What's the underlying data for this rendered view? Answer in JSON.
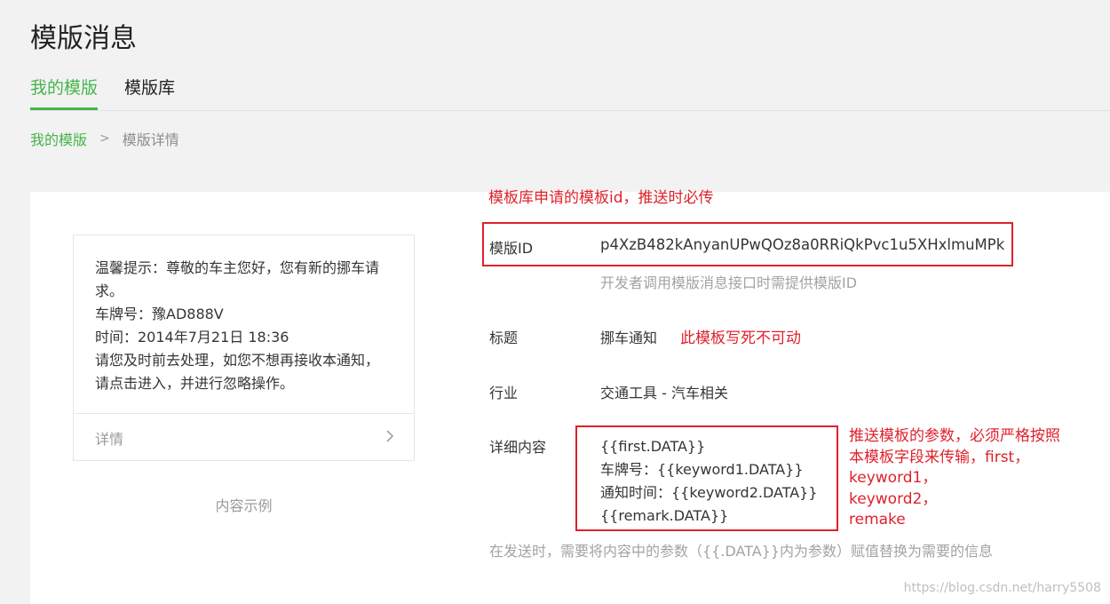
{
  "page": {
    "title": "模版消息"
  },
  "tabs": [
    {
      "label": "我的模版",
      "active": true
    },
    {
      "label": "模版库",
      "active": false
    }
  ],
  "breadcrumb": {
    "parent": "我的模版",
    "separator": ">",
    "current": "模版详情"
  },
  "preview": {
    "lines": [
      "温馨提示：尊敬的车主您好，您有新的挪车请",
      "求。",
      "车牌号：豫AD888V",
      "时间：2014年7月21日 18:36",
      "请您及时前去处理，如您不想再接收本通知，",
      "请点击进入，并进行忽略操作。"
    ],
    "footer_label": "详情",
    "footer_icon": "chevron-right-icon",
    "caption": "内容示例"
  },
  "details": {
    "template_id": {
      "label": "模版ID",
      "value": "p4XzB482kAnyanUPwQOz8a0RRiQkPvc1u5XHxlmuMPk",
      "hint": "开发者调用模版消息接口时需提供模版ID"
    },
    "title": {
      "label": "标题",
      "value": "挪车通知"
    },
    "industry": {
      "label": "行业",
      "value": "交通工具 - 汽车相关"
    },
    "content": {
      "label": "详细内容",
      "lines": [
        "{{first.DATA}}",
        "车牌号：{{keyword1.DATA}}",
        "通知时间：{{keyword2.DATA}}",
        "{{remark.DATA}}"
      ],
      "hint": "在发送时，需要将内容中的参数（{{.DATA}}内为参数）赋值替换为需要的信息"
    }
  },
  "annotations": {
    "template_id_note": "模板库申请的模板id，推送时必传",
    "title_note": "此模板写死不可动",
    "content_note_lines": [
      "推送模板的参数，必须严格按照",
      "本模板字段来传输，first，",
      "keyword1，",
      "keyword2，",
      "remake"
    ]
  },
  "watermark": "https://blog.csdn.net/harry5508",
  "colors": {
    "accent": "#44b549",
    "annotation": "#e0212b"
  }
}
